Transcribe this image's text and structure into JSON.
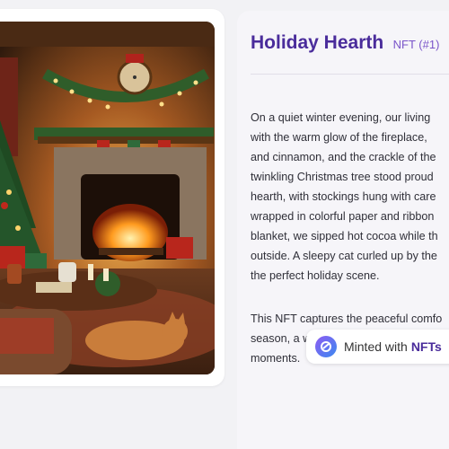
{
  "nft": {
    "title": "Holiday Hearth",
    "badge": "NFT (#1)",
    "image_alt": "Cozy living room with a fireplace, Christmas tree and sleeping cat",
    "description_1": "On a quiet winter evening, our living\nwith the warm glow of the fireplace,\nand cinnamon, and the crackle of the\ntwinkling Christmas tree stood proud\nhearth, with stockings hung with care\nwrapped in colorful paper and ribbon\nblanket, we sipped hot cocoa while th\noutside. A sleepy cat curled up by the\nthe perfect holiday scene.",
    "description_2": "This NFT captures the peaceful comfo\nseason, a warm haven of togetherness\nmoments."
  },
  "minted": {
    "label": "Minted with",
    "brand": "NFTs"
  },
  "colors": {
    "title": "#4a2c9b",
    "accent": "#7a55c9",
    "panel": "#f6f5f9"
  },
  "icons": [
    "minted-logo-icon"
  ]
}
